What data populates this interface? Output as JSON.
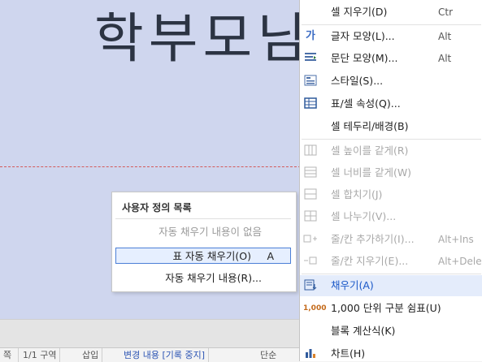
{
  "document": {
    "heading": "학부모님"
  },
  "status_bar": {
    "items": [
      "1/1 구역",
      "삽입",
      "변경 내용 [기록 중지]",
      "단순"
    ]
  },
  "submenu": {
    "title": "사용자 정의 목록",
    "items": [
      {
        "label": "자동 채우기 내용이 없음",
        "accel": "",
        "state": "disabled"
      },
      {
        "label": "표 자동 채우기(O)",
        "accel": "A",
        "state": "selected"
      },
      {
        "label": "자동 채우기 내용(R)...",
        "accel": "",
        "state": "normal"
      }
    ]
  },
  "context_menu": {
    "items": [
      {
        "label": "셀 지우기(D)",
        "shortcut": "Ctr",
        "icon": "",
        "state": "normal"
      },
      {
        "label": "글자 모양(L)...",
        "shortcut": "Alt",
        "icon": "font-shape-icon",
        "state": "normal"
      },
      {
        "label": "문단 모양(M)...",
        "shortcut": "Alt",
        "icon": "paragraph-icon",
        "state": "normal"
      },
      {
        "label": "스타일(S)...",
        "shortcut": "",
        "icon": "style-icon",
        "state": "normal"
      },
      {
        "label": "표/셀 속성(Q)...",
        "shortcut": "",
        "icon": "table-props-icon",
        "state": "normal"
      },
      {
        "label": "셀 테두리/배경(B)",
        "shortcut": "",
        "icon": "",
        "state": "normal"
      },
      {
        "label": "셀 높이를 같게(R)",
        "shortcut": "",
        "icon": "equal-height-icon",
        "state": "disabled"
      },
      {
        "label": "셀 너비를 같게(W)",
        "shortcut": "",
        "icon": "equal-width-icon",
        "state": "disabled"
      },
      {
        "label": "셀 합치기(J)",
        "shortcut": "",
        "icon": "merge-cells-icon",
        "state": "disabled"
      },
      {
        "label": "셀 나누기(V)...",
        "shortcut": "",
        "icon": "split-cells-icon",
        "state": "disabled"
      },
      {
        "label": "줄/칸 추가하기(I)...",
        "shortcut": "Alt+Ins",
        "icon": "add-row-col-icon",
        "state": "disabled"
      },
      {
        "label": "줄/칸 지우기(E)...",
        "shortcut": "Alt+Dele",
        "icon": "delete-row-col-icon",
        "state": "disabled"
      },
      {
        "label": "채우기(A)",
        "shortcut": "",
        "icon": "fill-icon",
        "state": "highlight"
      },
      {
        "label": "1,000 단위 구분 쉼표(U)",
        "shortcut": "",
        "icon": "thousands-separator-icon",
        "state": "normal"
      },
      {
        "label": "블록 계산식(K)",
        "shortcut": "",
        "icon": "",
        "state": "normal"
      },
      {
        "label": "차트(H)",
        "shortcut": "",
        "icon": "chart-icon",
        "state": "normal"
      }
    ]
  },
  "colors": {
    "document_bg": "#cfd6ee",
    "highlight_text": "#1a58c8",
    "highlight_bg": "#e4ecfb",
    "selected_border": "#4b7fd6"
  }
}
